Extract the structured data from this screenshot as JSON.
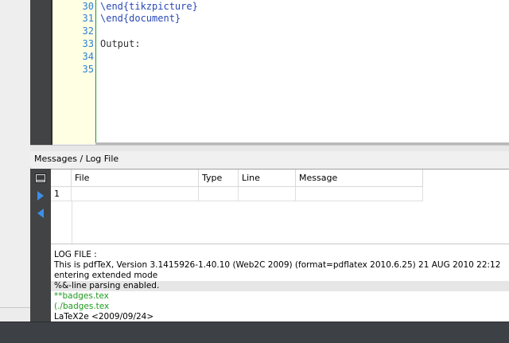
{
  "editor": {
    "lines": [
      {
        "num": "30",
        "text": "\\end{tikzpicture}"
      },
      {
        "num": "31",
        "text": "\\end{document}"
      },
      {
        "num": "32",
        "text": ""
      },
      {
        "num": "33",
        "text": "Output:"
      },
      {
        "num": "34",
        "text": ""
      },
      {
        "num": "35",
        "text": ""
      }
    ]
  },
  "messages": {
    "title": "Messages / Log File",
    "columns": [
      "File",
      "Type",
      "Line",
      "Message"
    ],
    "rows": [
      {
        "index": "1",
        "file": "",
        "type": "",
        "line": "",
        "message": ""
      }
    ]
  },
  "log": {
    "lines": [
      "LOG FILE :",
      "This is pdfTeX, Version 3.1415926-1.40.10 (Web2C 2009) (format=pdflatex 2010.6.25) 21 AUG 2010 22:12",
      "entering extended mode",
      "%&-line parsing enabled.",
      "**badges.tex",
      "(./badges.tex",
      "LaTeX2e <2009/09/24>"
    ]
  },
  "icons": {
    "log_view": "log-view-icon",
    "next": "next-arrow-icon",
    "prev": "previous-arrow-icon"
  },
  "colors": {
    "line_numbers": "#2c7fd6",
    "gutter_bg": "#ffffe4",
    "keyword": "#2a49b8",
    "log_green": "#1f9a1f",
    "toolbar_dark": "#414345"
  }
}
